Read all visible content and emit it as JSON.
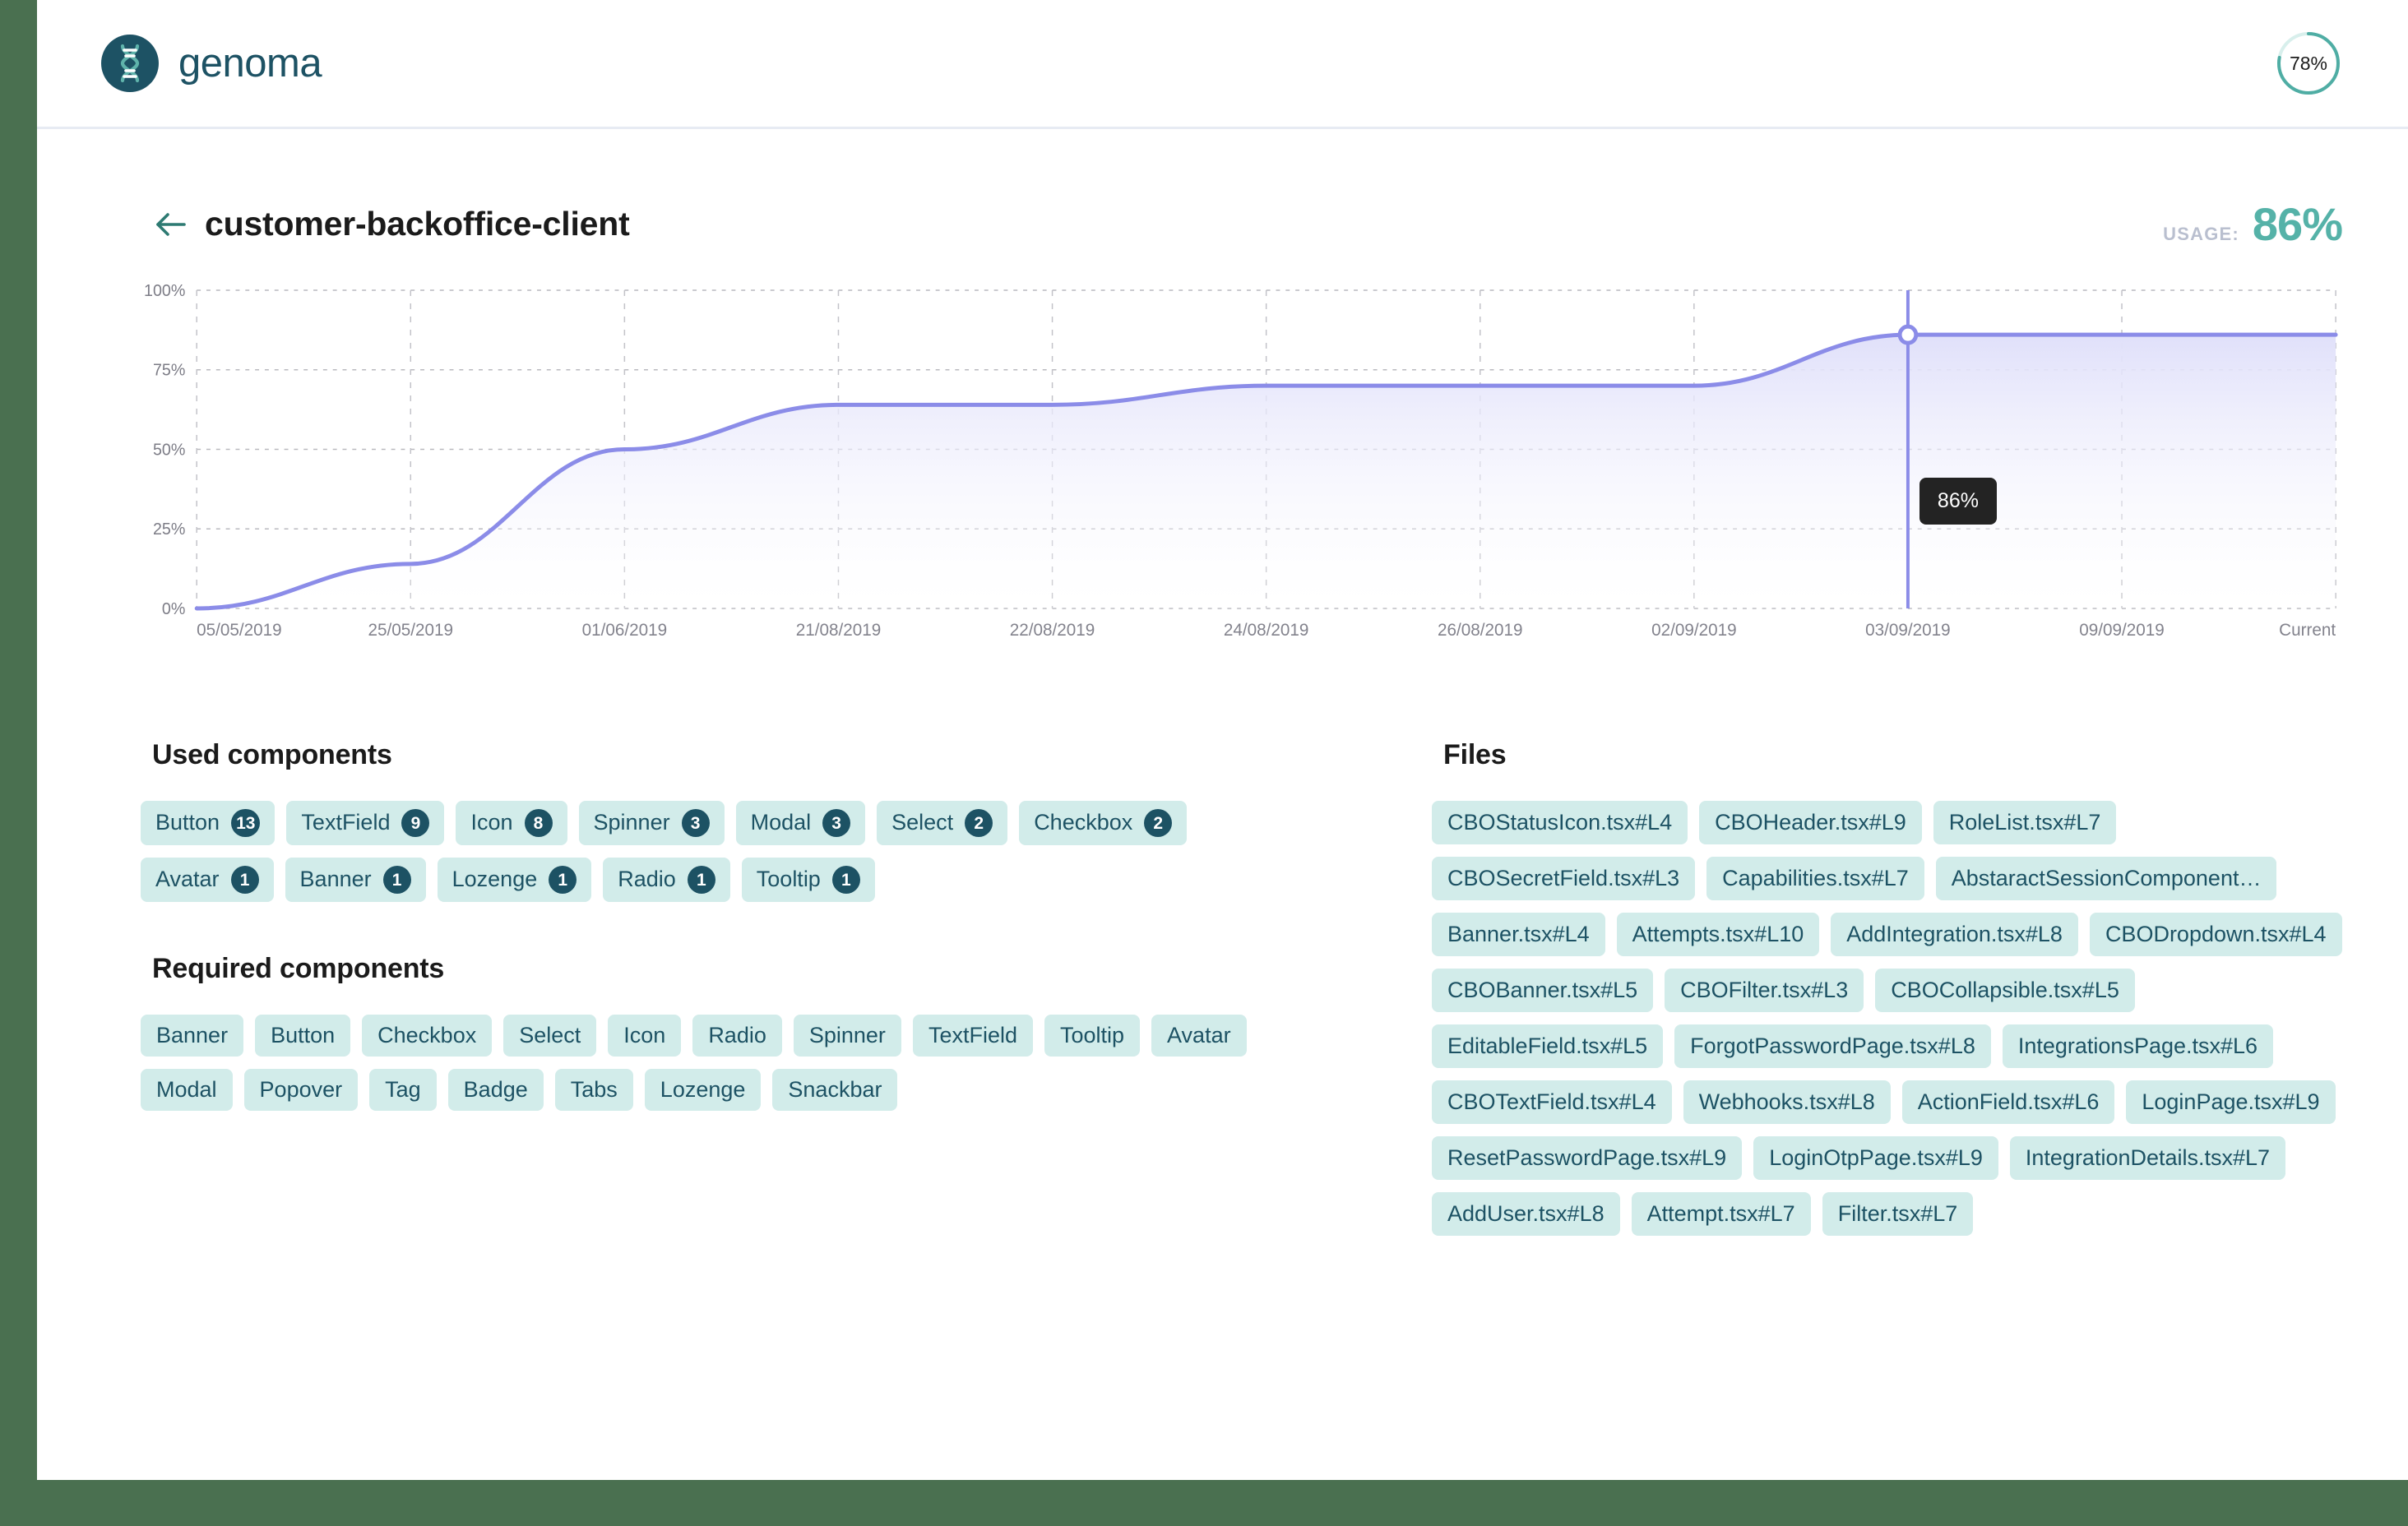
{
  "topbar": {
    "brand_name": "genoma",
    "brand_icon": "dna-helix-icon",
    "overall_percent": "78%",
    "overall_value": 78,
    "ring_track_color": "#d8efec",
    "ring_fill_color": "#4fada4"
  },
  "header": {
    "back_icon": "arrow-left-icon",
    "title": "customer-backoffice-client",
    "usage_label": "USAGE:",
    "usage_value": "86%",
    "accent_color": "#55b2a8"
  },
  "chart_data": {
    "type": "area",
    "title": "",
    "xlabel": "",
    "ylabel": "",
    "ylim": [
      0,
      100
    ],
    "ytick_labels": [
      "100%",
      "75%",
      "50%",
      "25%",
      "0%"
    ],
    "yticks": [
      100,
      75,
      50,
      25,
      0
    ],
    "grid": true,
    "legend": "none",
    "line_color": "#8b8ce8",
    "fill_top_color": "#e3e3fa",
    "fill_bottom_color": "#ffffff",
    "categories": [
      "05/05/2019",
      "25/05/2019",
      "01/06/2019",
      "21/08/2019",
      "22/08/2019",
      "24/08/2019",
      "26/08/2019",
      "02/09/2019",
      "03/09/2019",
      "09/09/2019",
      "Current"
    ],
    "values": [
      0,
      14,
      50,
      64,
      64,
      70,
      70,
      70,
      86,
      86,
      86
    ],
    "highlight": {
      "index": 8,
      "category": "03/09/2019",
      "value": 86,
      "label": "86%",
      "marker": "circle-outline",
      "crosshair_color": "#8b8ce8",
      "tooltip_bg": "#232323",
      "tooltip_text_color": "#ffffff"
    }
  },
  "used_components": {
    "title": "Used components",
    "items": [
      {
        "label": "Button",
        "count": "13"
      },
      {
        "label": "TextField",
        "count": "9"
      },
      {
        "label": "Icon",
        "count": "8"
      },
      {
        "label": "Spinner",
        "count": "3"
      },
      {
        "label": "Modal",
        "count": "3"
      },
      {
        "label": "Select",
        "count": "2"
      },
      {
        "label": "Checkbox",
        "count": "2"
      },
      {
        "label": "Avatar",
        "count": "1"
      },
      {
        "label": "Banner",
        "count": "1"
      },
      {
        "label": "Lozenge",
        "count": "1"
      },
      {
        "label": "Radio",
        "count": "1"
      },
      {
        "label": "Tooltip",
        "count": "1"
      }
    ]
  },
  "required_components": {
    "title": "Required components",
    "items": [
      "Banner",
      "Button",
      "Checkbox",
      "Select",
      "Icon",
      "Radio",
      "Spinner",
      "TextField",
      "Tooltip",
      "Avatar",
      "Modal",
      "Popover",
      "Tag",
      "Badge",
      "Tabs",
      "Lozenge",
      "Snackbar"
    ]
  },
  "files": {
    "title": "Files",
    "items": [
      "CBOStatusIcon.tsx#L4",
      "CBOHeader.tsx#L9",
      "RoleList.tsx#L7",
      "CBOSecretField.tsx#L3",
      "Capabilities.tsx#L7",
      "AbstaractSessionComponent…",
      "Banner.tsx#L4",
      "Attempts.tsx#L10",
      "AddIntegration.tsx#L8",
      "CBODropdown.tsx#L4",
      "CBOBanner.tsx#L5",
      "CBOFilter.tsx#L3",
      "CBOCollapsible.tsx#L5",
      "EditableField.tsx#L5",
      "ForgotPasswordPage.tsx#L8",
      "IntegrationsPage.tsx#L6",
      "CBOTextField.tsx#L4",
      "Webhooks.tsx#L8",
      "ActionField.tsx#L6",
      "LoginPage.tsx#L9",
      "ResetPasswordPage.tsx#L9",
      "LoginOtpPage.tsx#L9",
      "IntegrationDetails.tsx#L7",
      "AddUser.tsx#L8",
      "Attempt.tsx#L7",
      "Filter.tsx#L7"
    ]
  },
  "theme": {
    "page_background": "#4a7050",
    "chip_bg": "#d2ecea",
    "chip_text": "#1d5264"
  }
}
